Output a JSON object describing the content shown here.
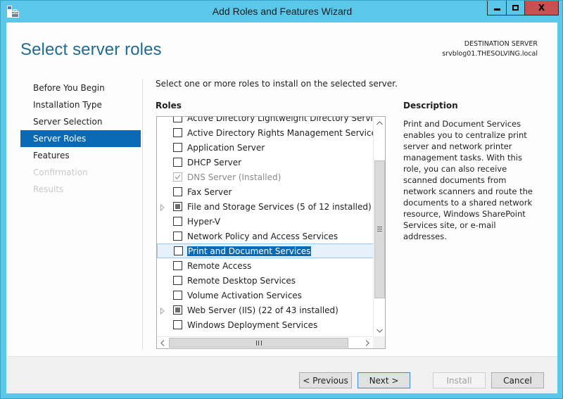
{
  "window": {
    "title": "Add Roles and Features Wizard",
    "icon": "server-manager-briefcase-icon",
    "controls": {
      "minimize": "minimize-icon",
      "maximize": "maximize-icon",
      "close": "X"
    }
  },
  "header": {
    "title": "Select server roles",
    "destination_label": "DESTINATION SERVER",
    "destination_server": "srvblog01.THESOLVING.local"
  },
  "nav": {
    "items": [
      {
        "label": "Before You Begin",
        "state": "normal"
      },
      {
        "label": "Installation Type",
        "state": "normal"
      },
      {
        "label": "Server Selection",
        "state": "normal"
      },
      {
        "label": "Server Roles",
        "state": "active"
      },
      {
        "label": "Features",
        "state": "normal"
      },
      {
        "label": "Confirmation",
        "state": "disabled"
      },
      {
        "label": "Results",
        "state": "disabled"
      }
    ]
  },
  "main": {
    "instruction": "Select one or more roles to install on the selected server.",
    "roles_label": "Roles",
    "roles": [
      {
        "label": "Active Directory Lightweight Directory Services",
        "state": "unchecked",
        "expandable": false
      },
      {
        "label": "Active Directory Rights Management Services",
        "state": "unchecked",
        "expandable": false
      },
      {
        "label": "Application Server",
        "state": "unchecked",
        "expandable": false
      },
      {
        "label": "DHCP Server",
        "state": "unchecked",
        "expandable": false
      },
      {
        "label": "DNS Server (Installed)",
        "state": "checked-disabled",
        "expandable": false
      },
      {
        "label": "Fax Server",
        "state": "unchecked",
        "expandable": false
      },
      {
        "label": "File and Storage Services (5 of 12 installed)",
        "state": "partial",
        "expandable": true
      },
      {
        "label": "Hyper-V",
        "state": "unchecked",
        "expandable": false
      },
      {
        "label": "Network Policy and Access Services",
        "state": "unchecked",
        "expandable": false
      },
      {
        "label": "Print and Document Services",
        "state": "unchecked",
        "expandable": false,
        "selected": true
      },
      {
        "label": "Remote Access",
        "state": "unchecked",
        "expandable": false
      },
      {
        "label": "Remote Desktop Services",
        "state": "unchecked",
        "expandable": false
      },
      {
        "label": "Volume Activation Services",
        "state": "unchecked",
        "expandable": false
      },
      {
        "label": "Web Server (IIS) (22 of 43 installed)",
        "state": "partial",
        "expandable": true
      },
      {
        "label": "Windows Deployment Services",
        "state": "unchecked",
        "expandable": false
      }
    ],
    "scroll": {
      "up": "^",
      "down": "v",
      "left": "<",
      "right": ">"
    }
  },
  "description": {
    "title": "Description",
    "text": "Print and Document Services enables you to centralize print server and network printer management tasks. With this role, you can also receive scanned documents from network scanners and route the documents to a shared network resource, Windows SharePoint Services site, or e-mail addresses."
  },
  "footer": {
    "previous": "< Previous",
    "next": "Next >",
    "install": "Install",
    "cancel": "Cancel"
  },
  "colors": {
    "chrome": "#5bc8ea",
    "accent": "#0b6ab6",
    "header_title": "#1e6c93",
    "close": "#c75050"
  }
}
